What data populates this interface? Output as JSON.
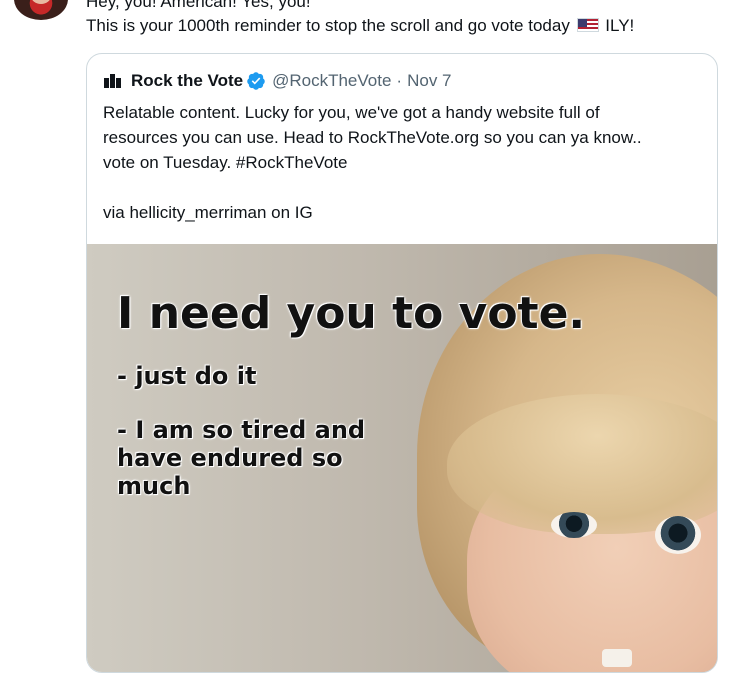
{
  "tweet": {
    "line1": "Hey, you! American! Yes, you!",
    "line2_text": "This is your 1000th reminder to stop the scroll and go vote today",
    "line2_after_flag": "ILY!",
    "flag_icon": "us-flag-emoji"
  },
  "quote": {
    "name": "Rock the Vote",
    "handle": "@RockTheVote",
    "separator": "·",
    "date": "Nov 7",
    "body_lines": [
      "Relatable content. Lucky for you, we've got a handy website full of",
      "resources you can use. Head to RockTheVote.org so you can ya know..",
      "vote on Tuesday. #RockTheVote"
    ],
    "via": "via hellicity_merriman on IG",
    "verified_color": "#1d9bf0"
  },
  "media": {
    "title": "I need you to vote.",
    "line1": "- just do it",
    "line2": "- I am so tired and have endured so much"
  }
}
